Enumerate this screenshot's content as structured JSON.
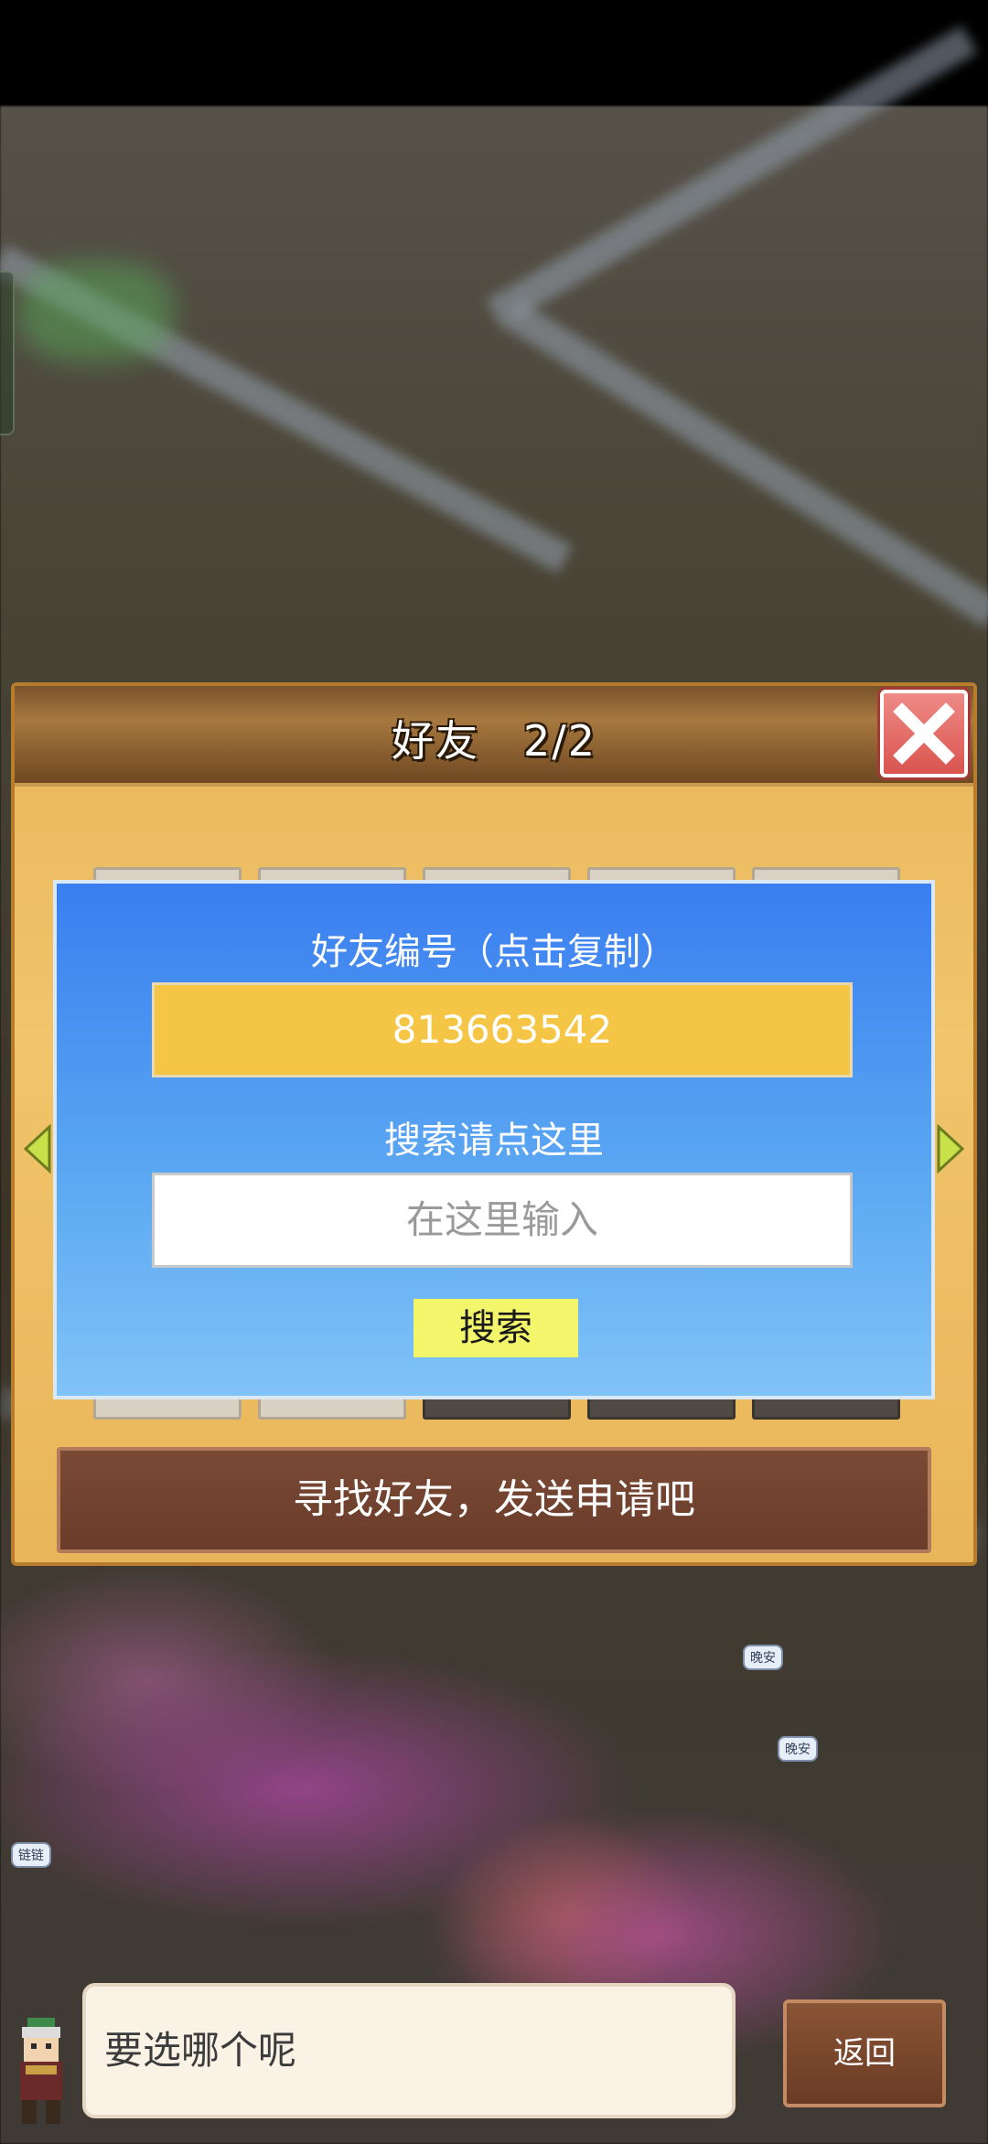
{
  "panel": {
    "title": "好友　2/2",
    "close_icon": "close-icon"
  },
  "modal": {
    "id_label": "好友编号（点击复制）",
    "friend_id": "813663542",
    "search_label": "搜索请点这里",
    "search_placeholder": "在这里输入",
    "search_button": "搜索"
  },
  "find_friends_label": "寻找好友，发送申请吧",
  "dialog": {
    "text": "要选哪个呢"
  },
  "back_button": "返回",
  "world_bubbles": [
    "晚安",
    "晚安",
    "链链"
  ],
  "colors": {
    "panel": "#f1c56b",
    "modal_top": "#3a7ef0",
    "id_box": "#f5c645",
    "search_button": "#f3f56b",
    "close_button": "#d9544f"
  }
}
